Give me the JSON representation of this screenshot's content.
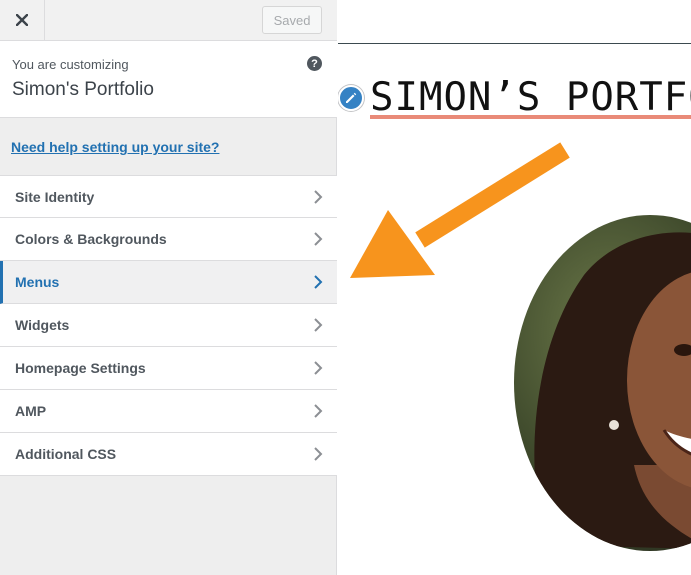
{
  "topbar": {
    "saved_label": "Saved"
  },
  "info": {
    "pre": "You are customizing",
    "site_name": "Simon's Portfolio",
    "help_icon_glyph": "?"
  },
  "help_link": "Need help setting up your site?",
  "panels": [
    {
      "label": "Site Identity",
      "active": false
    },
    {
      "label": "Colors & Backgrounds",
      "active": false
    },
    {
      "label": "Menus",
      "active": true
    },
    {
      "label": "Widgets",
      "active": false
    },
    {
      "label": "Homepage Settings",
      "active": false
    },
    {
      "label": "AMP",
      "active": false
    },
    {
      "label": "Additional CSS",
      "active": false
    }
  ],
  "preview": {
    "site_title": "SIMON’S PORTFOLIO",
    "accent_color": "#e98a78",
    "edit_color": "#3582c4"
  },
  "icons": {
    "close": "close-icon",
    "help": "help-icon",
    "chevron": "chevron-right-icon",
    "edit": "pencil-icon",
    "arrow": "orange-arrow"
  },
  "colors": {
    "link": "#2271b1",
    "arrow": "#f7941d"
  }
}
